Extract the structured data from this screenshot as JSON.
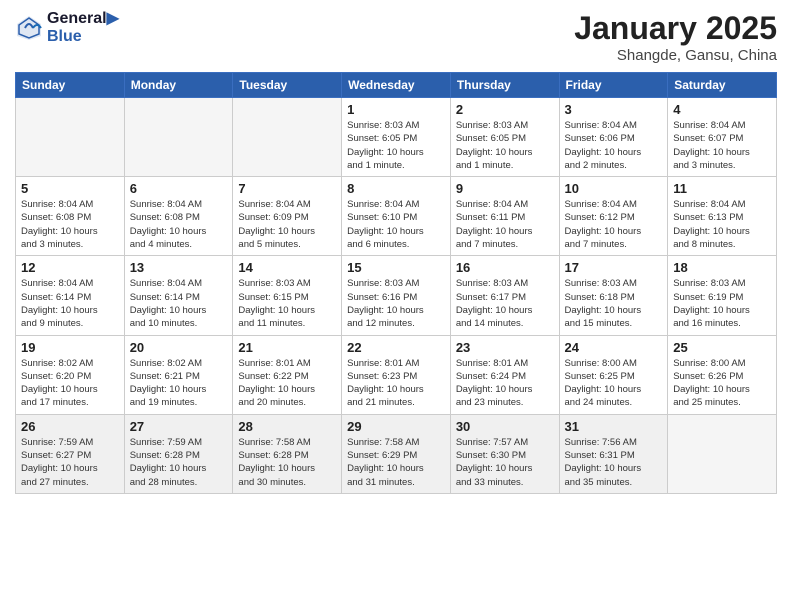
{
  "header": {
    "logo_line1": "General",
    "logo_line2": "Blue",
    "month_title": "January 2025",
    "location": "Shangde, Gansu, China"
  },
  "days_of_week": [
    "Sunday",
    "Monday",
    "Tuesday",
    "Wednesday",
    "Thursday",
    "Friday",
    "Saturday"
  ],
  "weeks": [
    [
      {
        "day": "",
        "info": ""
      },
      {
        "day": "",
        "info": ""
      },
      {
        "day": "",
        "info": ""
      },
      {
        "day": "1",
        "info": "Sunrise: 8:03 AM\nSunset: 6:05 PM\nDaylight: 10 hours\nand 1 minute."
      },
      {
        "day": "2",
        "info": "Sunrise: 8:03 AM\nSunset: 6:05 PM\nDaylight: 10 hours\nand 1 minute."
      },
      {
        "day": "3",
        "info": "Sunrise: 8:04 AM\nSunset: 6:06 PM\nDaylight: 10 hours\nand 2 minutes."
      },
      {
        "day": "4",
        "info": "Sunrise: 8:04 AM\nSunset: 6:07 PM\nDaylight: 10 hours\nand 3 minutes."
      }
    ],
    [
      {
        "day": "5",
        "info": "Sunrise: 8:04 AM\nSunset: 6:08 PM\nDaylight: 10 hours\nand 3 minutes."
      },
      {
        "day": "6",
        "info": "Sunrise: 8:04 AM\nSunset: 6:08 PM\nDaylight: 10 hours\nand 4 minutes."
      },
      {
        "day": "7",
        "info": "Sunrise: 8:04 AM\nSunset: 6:09 PM\nDaylight: 10 hours\nand 5 minutes."
      },
      {
        "day": "8",
        "info": "Sunrise: 8:04 AM\nSunset: 6:10 PM\nDaylight: 10 hours\nand 6 minutes."
      },
      {
        "day": "9",
        "info": "Sunrise: 8:04 AM\nSunset: 6:11 PM\nDaylight: 10 hours\nand 7 minutes."
      },
      {
        "day": "10",
        "info": "Sunrise: 8:04 AM\nSunset: 6:12 PM\nDaylight: 10 hours\nand 7 minutes."
      },
      {
        "day": "11",
        "info": "Sunrise: 8:04 AM\nSunset: 6:13 PM\nDaylight: 10 hours\nand 8 minutes."
      }
    ],
    [
      {
        "day": "12",
        "info": "Sunrise: 8:04 AM\nSunset: 6:14 PM\nDaylight: 10 hours\nand 9 minutes."
      },
      {
        "day": "13",
        "info": "Sunrise: 8:04 AM\nSunset: 6:14 PM\nDaylight: 10 hours\nand 10 minutes."
      },
      {
        "day": "14",
        "info": "Sunrise: 8:03 AM\nSunset: 6:15 PM\nDaylight: 10 hours\nand 11 minutes."
      },
      {
        "day": "15",
        "info": "Sunrise: 8:03 AM\nSunset: 6:16 PM\nDaylight: 10 hours\nand 12 minutes."
      },
      {
        "day": "16",
        "info": "Sunrise: 8:03 AM\nSunset: 6:17 PM\nDaylight: 10 hours\nand 14 minutes."
      },
      {
        "day": "17",
        "info": "Sunrise: 8:03 AM\nSunset: 6:18 PM\nDaylight: 10 hours\nand 15 minutes."
      },
      {
        "day": "18",
        "info": "Sunrise: 8:03 AM\nSunset: 6:19 PM\nDaylight: 10 hours\nand 16 minutes."
      }
    ],
    [
      {
        "day": "19",
        "info": "Sunrise: 8:02 AM\nSunset: 6:20 PM\nDaylight: 10 hours\nand 17 minutes."
      },
      {
        "day": "20",
        "info": "Sunrise: 8:02 AM\nSunset: 6:21 PM\nDaylight: 10 hours\nand 19 minutes."
      },
      {
        "day": "21",
        "info": "Sunrise: 8:01 AM\nSunset: 6:22 PM\nDaylight: 10 hours\nand 20 minutes."
      },
      {
        "day": "22",
        "info": "Sunrise: 8:01 AM\nSunset: 6:23 PM\nDaylight: 10 hours\nand 21 minutes."
      },
      {
        "day": "23",
        "info": "Sunrise: 8:01 AM\nSunset: 6:24 PM\nDaylight: 10 hours\nand 23 minutes."
      },
      {
        "day": "24",
        "info": "Sunrise: 8:00 AM\nSunset: 6:25 PM\nDaylight: 10 hours\nand 24 minutes."
      },
      {
        "day": "25",
        "info": "Sunrise: 8:00 AM\nSunset: 6:26 PM\nDaylight: 10 hours\nand 25 minutes."
      }
    ],
    [
      {
        "day": "26",
        "info": "Sunrise: 7:59 AM\nSunset: 6:27 PM\nDaylight: 10 hours\nand 27 minutes."
      },
      {
        "day": "27",
        "info": "Sunrise: 7:59 AM\nSunset: 6:28 PM\nDaylight: 10 hours\nand 28 minutes."
      },
      {
        "day": "28",
        "info": "Sunrise: 7:58 AM\nSunset: 6:28 PM\nDaylight: 10 hours\nand 30 minutes."
      },
      {
        "day": "29",
        "info": "Sunrise: 7:58 AM\nSunset: 6:29 PM\nDaylight: 10 hours\nand 31 minutes."
      },
      {
        "day": "30",
        "info": "Sunrise: 7:57 AM\nSunset: 6:30 PM\nDaylight: 10 hours\nand 33 minutes."
      },
      {
        "day": "31",
        "info": "Sunrise: 7:56 AM\nSunset: 6:31 PM\nDaylight: 10 hours\nand 35 minutes."
      },
      {
        "day": "",
        "info": ""
      }
    ]
  ]
}
